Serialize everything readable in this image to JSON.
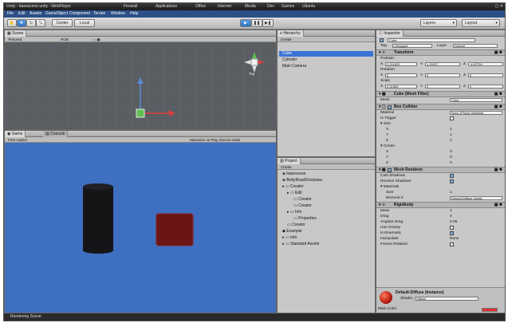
{
  "titlebar": {
    "text": "Unity - basescene.unity - WebPlayer",
    "taskbar_items": [
      "Firewall",
      "Applications",
      "Office",
      "Internet",
      "Media",
      "Dev",
      "Games",
      "Ubuntu"
    ]
  },
  "menubar": [
    "File",
    "Edit",
    "Assets",
    "GameObject",
    "Component",
    "Terrain",
    "Window",
    "Help"
  ],
  "toolbar": {
    "pivot_label": "Center",
    "space_label": "Local",
    "layers_label": "Layers",
    "layout_label": "Layout"
  },
  "scene": {
    "tab": "Scene",
    "shading": "Textured",
    "render_mode": "RGB",
    "gizmo_label": "Top"
  },
  "game": {
    "tab": "Game",
    "console_tab": "Console",
    "aspect": "Free Aspect",
    "options": "Maximize on Play  Gizmos  Stats",
    "cylinder_color": "#151518",
    "cube_color": "#6b1616",
    "background_color": "#3f6fc0"
  },
  "hierarchy": {
    "tab": "Hierarchy",
    "create": "Create",
    "items": [
      "Cube",
      "Cylinder",
      "Main Camera"
    ],
    "selected_index": 0
  },
  "project": {
    "tab": "Project",
    "create": "Create",
    "items": [
      "basescene",
      "BettyRoadOverpass",
      "Creator",
      "Edit",
      "Creator",
      "Creator",
      "Info",
      "Properties",
      "Creator",
      "Example",
      "Info",
      "Standard Assets"
    ]
  },
  "inspector": {
    "tab": "Inspector",
    "object_name": "Cube",
    "tag_label": "Tag",
    "tag_value": "Untagged",
    "layer_label": "Layer",
    "layer_value": "Default",
    "transform": {
      "header": "Transform",
      "position_label": "Position",
      "position": [
        "2.211822",
        "1.03227",
        "-4.02754"
      ],
      "rotation_label": "Rotation",
      "rotation": [
        "0",
        "0",
        "0"
      ],
      "scale_label": "Scale",
      "scale": [
        "2.01589",
        "2",
        "2"
      ]
    },
    "mesh_filter": {
      "header": "Cube (Mesh Filter)",
      "mesh_label": "Mesh",
      "mesh_value": "Cube"
    },
    "box_collider": {
      "header": "Box Collider",
      "material_label": "Material",
      "material_value": "None (Physic Material)",
      "trigger_label": "Is Trigger",
      "size_label": "Size",
      "size": [
        [
          "X",
          "1"
        ],
        [
          "Y",
          "1"
        ],
        [
          "Z",
          "1"
        ]
      ],
      "center_label": "Center",
      "center": [
        [
          "X",
          "0"
        ],
        [
          "Y",
          "0"
        ],
        [
          "Z",
          "0"
        ]
      ]
    },
    "mesh_renderer": {
      "header": "Mesh Renderer",
      "cast_label": "Cast Shadows",
      "receive_label": "Receive Shadows",
      "materials_label": "Materials",
      "size_label": "Size",
      "size_value": "1",
      "element_label": "Element 0",
      "element_value": "Default-Diffuse (Instar"
    },
    "rigidbody": {
      "header": "Rigidbody",
      "rows": [
        [
          "Mass",
          "1"
        ],
        [
          "Drag",
          "0"
        ],
        [
          "Angular Drag",
          "0.05"
        ],
        [
          "Use Gravity",
          ""
        ],
        [
          "Is Kinematic",
          ""
        ],
        [
          "Interpolate",
          "None"
        ],
        [
          "Freeze Rotation",
          ""
        ]
      ]
    },
    "material": {
      "name": "Default-Diffuse (Instance)",
      "shader_label": "Shader",
      "shader_value": "Diffuse",
      "main_color_label": "Main Color",
      "main_color": "#e03030"
    }
  },
  "statusbar": {
    "text": "Rendering Scene"
  }
}
